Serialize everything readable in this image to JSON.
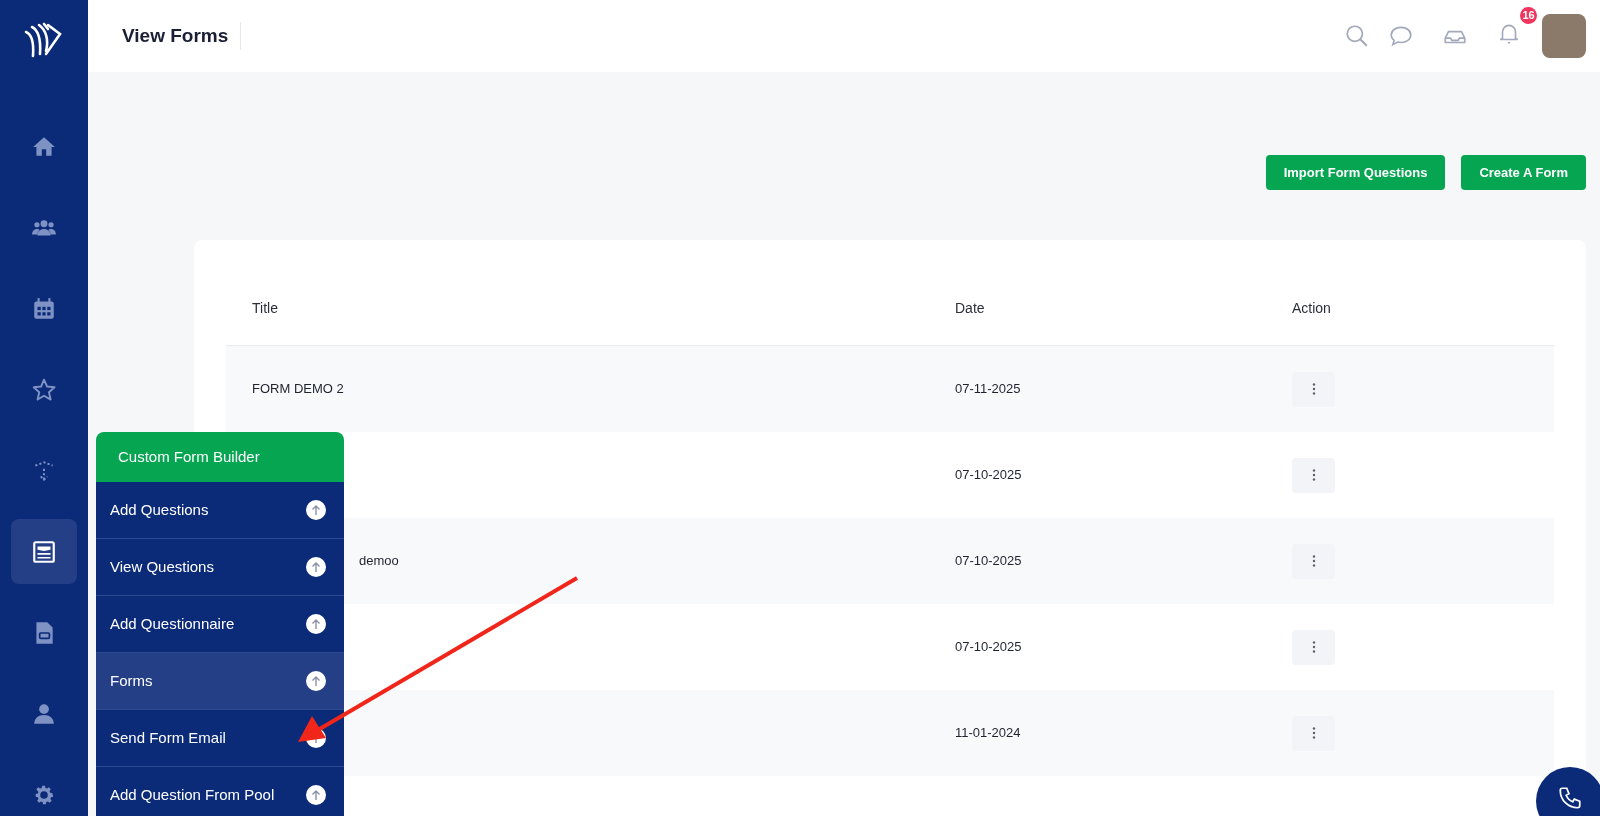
{
  "header": {
    "title": "View Forms",
    "notification_count": "16"
  },
  "sidebar": {
    "items": [
      {
        "selected": false
      },
      {
        "selected": false
      },
      {
        "selected": false
      },
      {
        "selected": false
      },
      {
        "selected": false
      },
      {
        "selected": true
      },
      {
        "selected": false
      },
      {
        "selected": false
      },
      {
        "selected": false
      }
    ]
  },
  "actions": [
    "Import Form Questions",
    "Create A Form"
  ],
  "table": {
    "columns": [
      "Title",
      "Date",
      "Action"
    ],
    "rows": [
      {
        "title": "FORM DEMO 2",
        "date": "07-11-2025"
      },
      {
        "date": "07-10-2025"
      },
      {
        "title": "demoo",
        "date": "07-10-2025"
      },
      {
        "date": "07-10-2025"
      },
      {
        "date": "11-01-2024"
      }
    ]
  },
  "flyout_menu": {
    "title": "Custom Form Builder",
    "items": [
      {
        "label": "Add Questions",
        "selected": false
      },
      {
        "label": "View Questions",
        "selected": false
      },
      {
        "label": "Add Questionnaire",
        "selected": false
      },
      {
        "label": "Forms",
        "selected": true
      },
      {
        "label": "Send Form Email",
        "selected": false
      },
      {
        "label": "Add Question From Pool",
        "selected": false
      }
    ]
  }
}
